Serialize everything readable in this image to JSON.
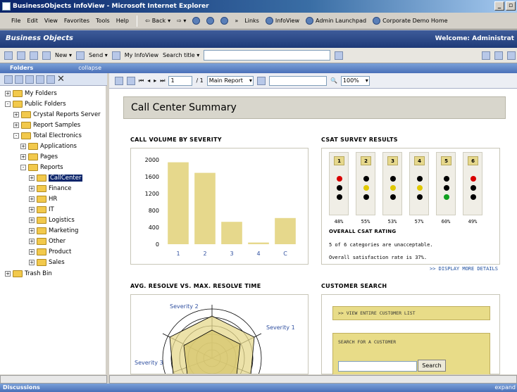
{
  "window": {
    "title": "BusinessObjects InfoView - Microsoft Internet Explorer",
    "minimize": "_",
    "maximize": "▫"
  },
  "menu": {
    "items": [
      "File",
      "Edit",
      "View",
      "Favorites",
      "Tools",
      "Help"
    ],
    "back": "Back",
    "links_label": "Links",
    "links": [
      "InfoView",
      "Admin Launchpad",
      "Corporate Demo Home"
    ]
  },
  "brand": {
    "logo": "Business Objects",
    "welcome": "Welcome: Administrat"
  },
  "toolbar": {
    "new_label": "New",
    "send_label": "Send",
    "myinfoview_label": "My InfoView",
    "search_label": "Search title",
    "search_value": ""
  },
  "folders_panel": {
    "title": "Folders",
    "collapse_label": "collapse",
    "tree": [
      {
        "label": "My Folders",
        "sign": "+",
        "level": 0
      },
      {
        "label": "Public Folders",
        "sign": "-",
        "level": 0
      },
      {
        "label": "Crystal Reports Server",
        "sign": "+",
        "level": 1
      },
      {
        "label": "Report Samples",
        "sign": "+",
        "level": 1
      },
      {
        "label": "Total Electronics",
        "sign": "-",
        "level": 1
      },
      {
        "label": "Applications",
        "sign": "+",
        "level": 2
      },
      {
        "label": "Pages",
        "sign": "+",
        "level": 2
      },
      {
        "label": "Reports",
        "sign": "-",
        "level": 2
      },
      {
        "label": "CallCenter",
        "sign": "+",
        "level": 3,
        "selected": true
      },
      {
        "label": "Finance",
        "sign": "+",
        "level": 3
      },
      {
        "label": "HR",
        "sign": "+",
        "level": 3
      },
      {
        "label": "IT",
        "sign": "+",
        "level": 3
      },
      {
        "label": "Logistics",
        "sign": "+",
        "level": 3
      },
      {
        "label": "Marketing",
        "sign": "+",
        "level": 3
      },
      {
        "label": "Other",
        "sign": "+",
        "level": 3
      },
      {
        "label": "Product",
        "sign": "+",
        "level": 3
      },
      {
        "label": "Sales",
        "sign": "+",
        "level": 3
      },
      {
        "label": "Trash Bin",
        "sign": "+",
        "level": 0
      }
    ]
  },
  "viewer": {
    "page_value": "1",
    "page_total": "/ 1",
    "report_select": "Main Report",
    "zoom": "100%"
  },
  "report": {
    "title": "Call Center Summary",
    "call_volume_title": "CALL VOLUME BY SEVERITY",
    "csat_title": "CSAT SURVEY RESULTS",
    "csat_columns": [
      {
        "num": "1",
        "dots": [
          "#d80000",
          "#000000",
          "#000000"
        ],
        "pct": "48%"
      },
      {
        "num": "2",
        "dots": [
          "#000000",
          "#e0c800",
          "#000000"
        ],
        "pct": "55%"
      },
      {
        "num": "3",
        "dots": [
          "#000000",
          "#e0c800",
          "#000000"
        ],
        "pct": "53%"
      },
      {
        "num": "4",
        "dots": [
          "#000000",
          "#e0c800",
          "#000000"
        ],
        "pct": "57%"
      },
      {
        "num": "5",
        "dots": [
          "#000000",
          "#000000",
          "#10a020"
        ],
        "pct": "60%"
      },
      {
        "num": "6",
        "dots": [
          "#d80000",
          "#000000",
          "#000000"
        ],
        "pct": "49%"
      }
    ],
    "overall_rating_title": "OVERALL CSAT RATING",
    "overall_line1": "5 of 6 categories are unacceptable.",
    "overall_line2": "Overall satisfaction rate is 37%.",
    "display_more": ">> DISPLAY MORE DETAILS",
    "resolve_title": "AVG. RESOLVE VS. MAX. RESOLVE TIME",
    "radar_labels": [
      "Severity 1",
      "Severity 2",
      "Severity 3"
    ],
    "customer_search_title": "CUSTOMER SEARCH",
    "view_list_label": ">> VIEW ENTIRE CUSTOMER LIST",
    "search_for_label": "SEARCH FOR A CUSTOMER",
    "search_button": "Search",
    "search_value": ""
  },
  "chart_data": {
    "type": "bar",
    "title": "CALL VOLUME BY SEVERITY",
    "categories": [
      "1",
      "2",
      "3",
      "4",
      "C"
    ],
    "values": [
      1940,
      1690,
      530,
      40,
      620
    ],
    "yticks": [
      "2000",
      "1600",
      "1200",
      "800",
      "400",
      "0"
    ],
    "ylim": [
      0,
      2000
    ],
    "bar_color": "#e6d88c"
  },
  "bottom": {
    "discussions": "Discussions",
    "expand": "expand"
  }
}
